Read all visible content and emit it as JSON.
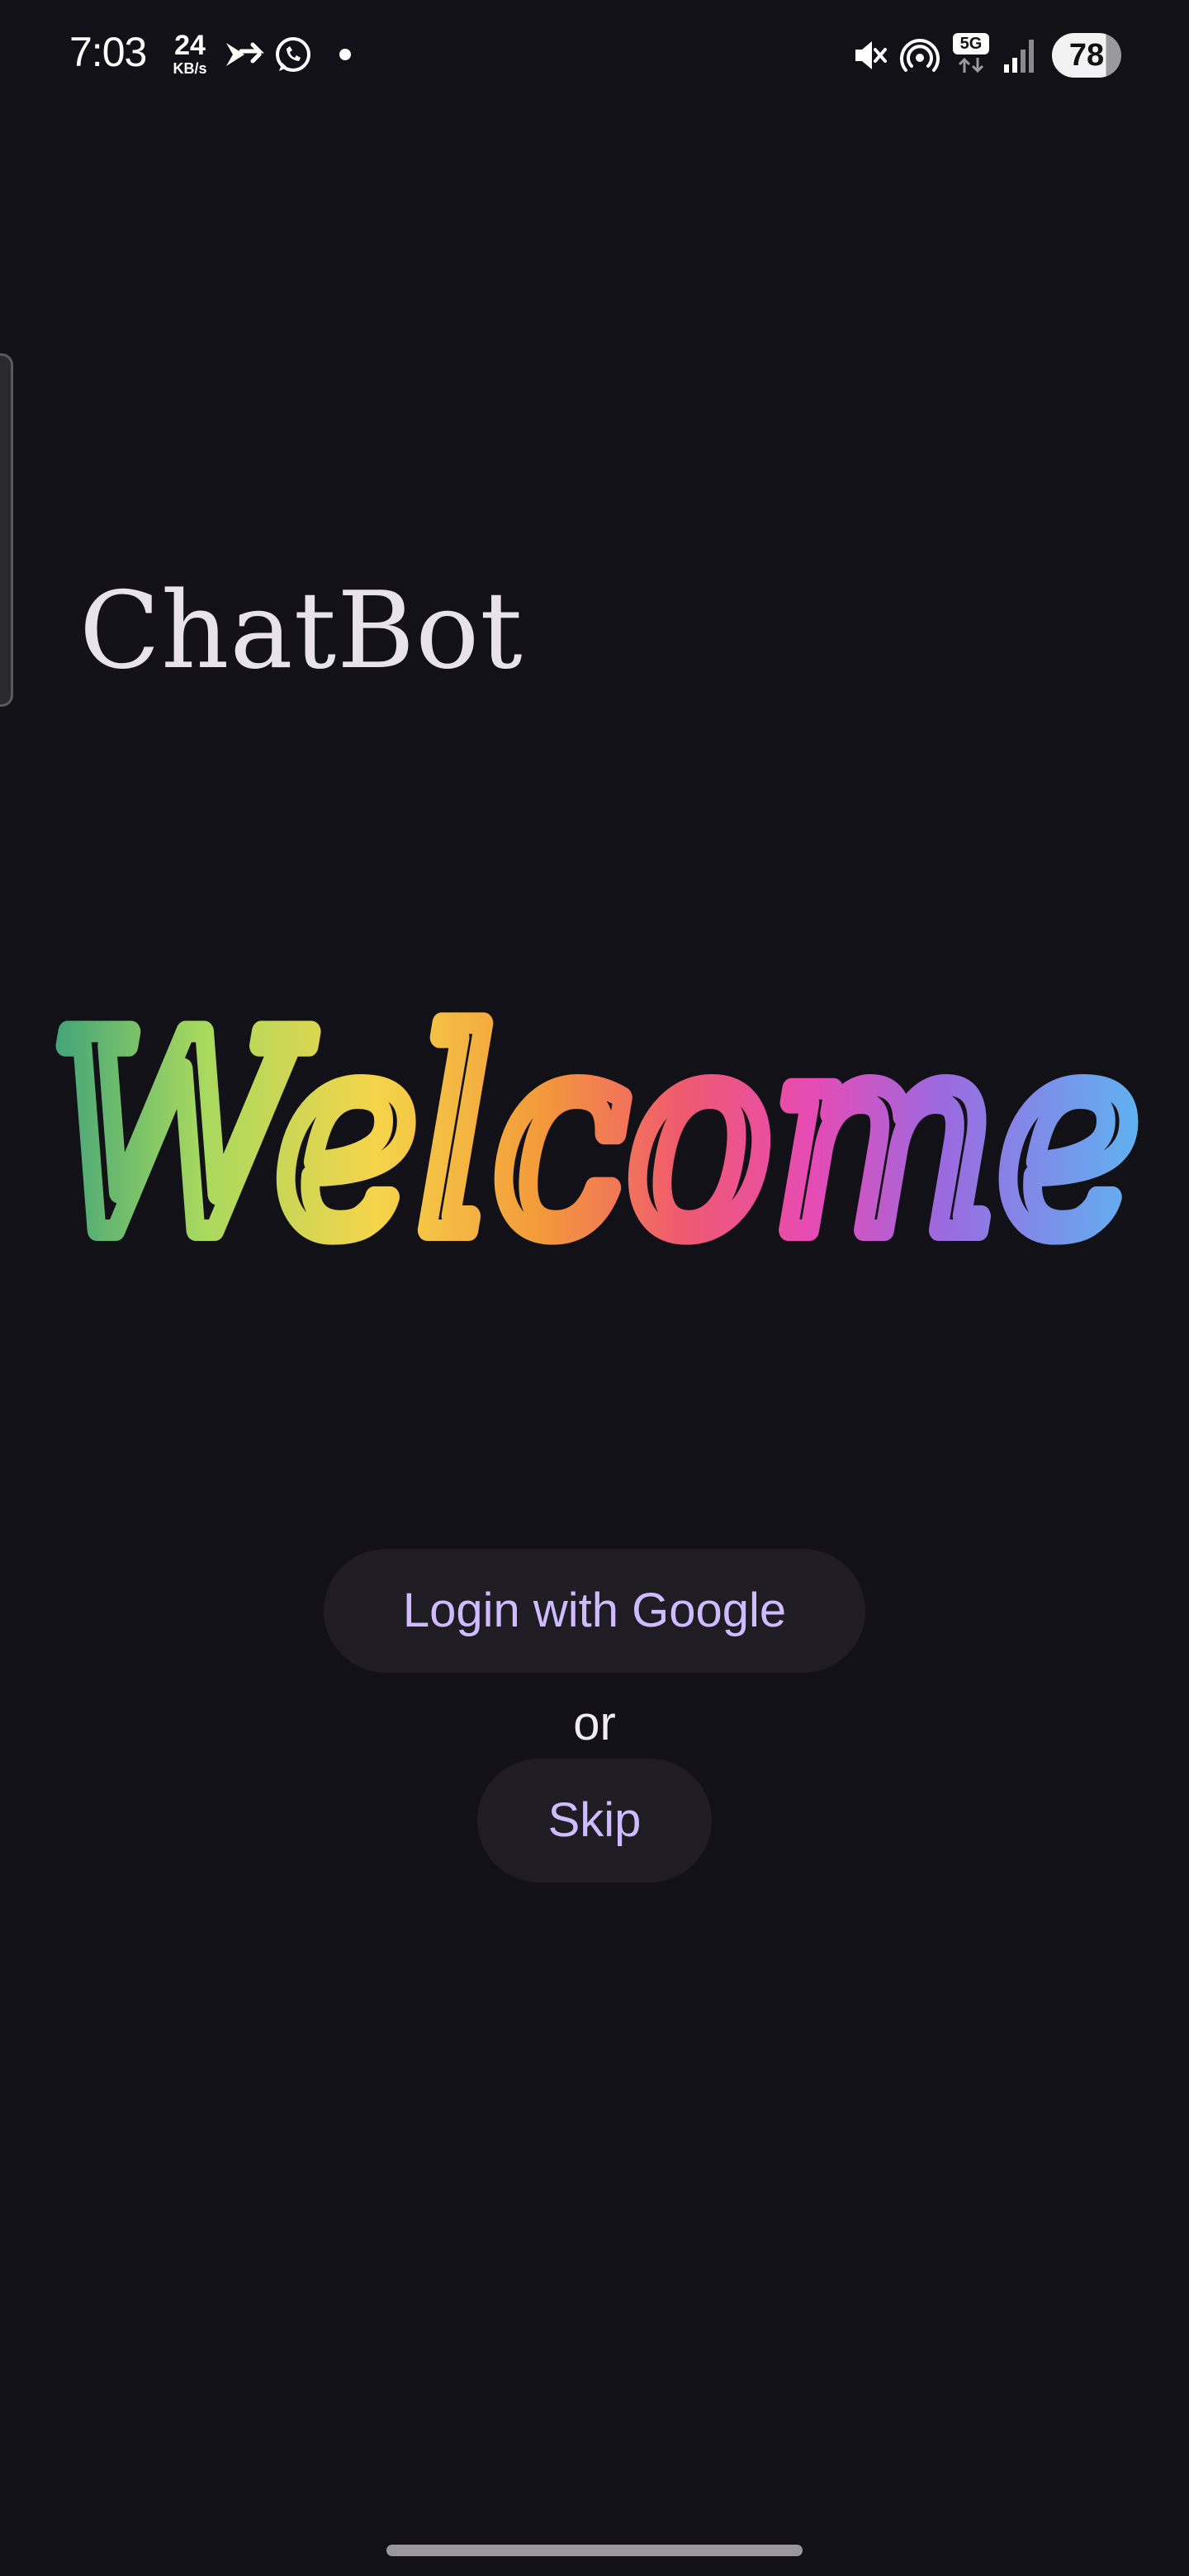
{
  "status_bar": {
    "time": "7:03",
    "net_speed_value": "24",
    "net_speed_unit": "KB/s",
    "network_type": "5G",
    "battery": "78",
    "icons": [
      "arrow-forward-icon",
      "whatsapp-icon",
      "dot-icon",
      "mute-icon",
      "hotspot-icon",
      "5g-icon",
      "signal-icon",
      "battery-icon"
    ]
  },
  "app": {
    "title": "ChatBot",
    "welcome_text": "Welcome"
  },
  "actions": {
    "login_google_label": "Login with Google",
    "or_label": "or",
    "skip_label": "Skip"
  },
  "colors": {
    "background": "#131118",
    "button_bg": "#1f1d23",
    "button_text": "#cfbcff",
    "title_text": "#e8e2ea",
    "welcome_gradient": [
      "#3fa27a",
      "#a7d95f",
      "#f5d44a",
      "#f39a3a",
      "#ef5a6f",
      "#e64bb5",
      "#9b6ae0",
      "#5fb2f0"
    ]
  }
}
